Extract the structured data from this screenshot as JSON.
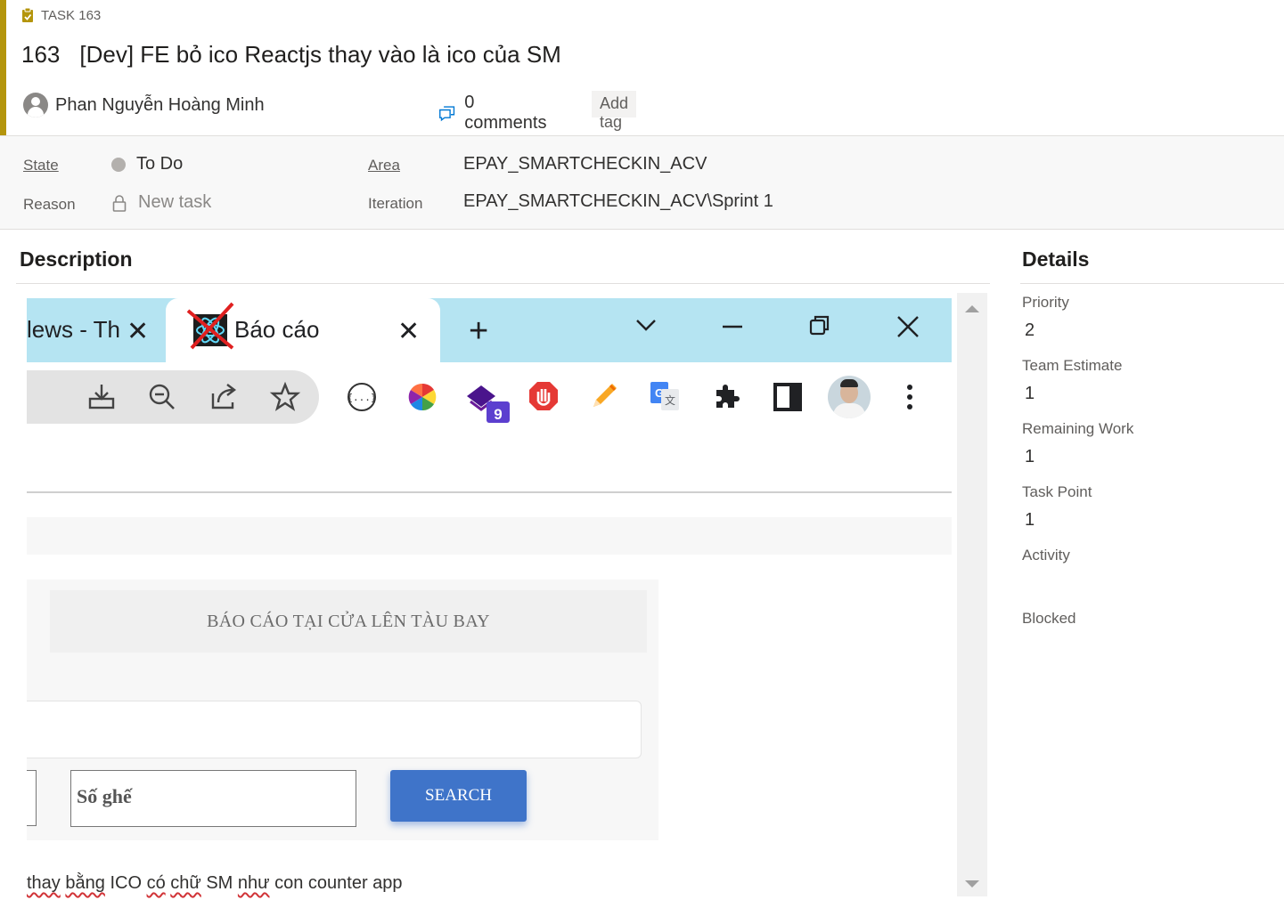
{
  "colors": {
    "accent": "#b4950c",
    "tabbar": "#b5e4f2",
    "search_button": "#3f74c9"
  },
  "header": {
    "type_label": "TASK 163",
    "id": "163",
    "title": "[Dev] FE bỏ ico Reactjs thay vào là ico của SM",
    "assignee": "Phan Nguyễn Hoàng Minh",
    "comments": "0 comments",
    "add_tag": "Add tag"
  },
  "fields": {
    "state_label": "State",
    "state_value": "To Do",
    "reason_label": "Reason",
    "reason_value": "New task",
    "area_label": "Area",
    "area_value": "EPAY_SMARTCHECKIN_ACV",
    "iteration_label": "Iteration",
    "iteration_value": "EPAY_SMARTCHECKIN_ACV\\Sprint 1"
  },
  "description": {
    "title": "Description",
    "screenshot": {
      "inactive_tab": "lews - Th",
      "active_tab": "Báo cáo",
      "extension_badge": "9",
      "panel_heading": "BÁO CÁO TẠI CỬA LÊN TÀU BAY",
      "seat_placeholder": "Số ghế",
      "search_button": "SEARCH"
    },
    "text": {
      "w1": "thay",
      "w2": "bằng",
      "w3": "ICO",
      "w4": "có",
      "w5": "chữ",
      "w6": "SM",
      "w7": "như",
      "w8": "con counter app"
    }
  },
  "details": {
    "title": "Details",
    "priority_label": "Priority",
    "priority_value": "2",
    "team_estimate_label": "Team Estimate",
    "team_estimate_value": "1",
    "remaining_work_label": "Remaining Work",
    "remaining_work_value": "1",
    "task_point_label": "Task Point",
    "task_point_value": "1",
    "activity_label": "Activity",
    "blocked_label": "Blocked"
  }
}
